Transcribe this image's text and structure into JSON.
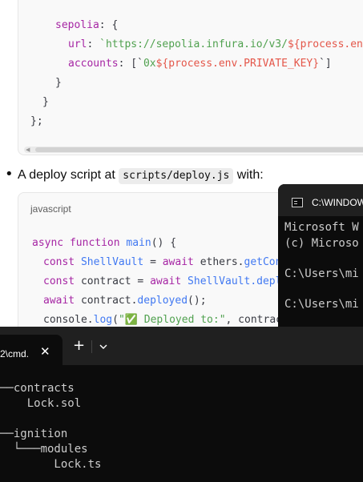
{
  "config_code": {
    "line1_key": "sepolia",
    "line1_rest": ": {",
    "line2_key": "url",
    "line2_colon": ": ",
    "line2_str": "`https://sepolia.infura.io/v3/",
    "line2_var": "${process.env",
    "line3_key": "accounts",
    "line3_pre": ": [`",
    "line3_str": "0x",
    "line3_var": "${process.env.PRIVATE_KEY}",
    "line3_post": "`]",
    "line4": "}",
    "line5": "}",
    "line6": "};"
  },
  "bullet": {
    "text_before": "A deploy script at ",
    "code": "scripts/deploy.js",
    "text_after": " with:"
  },
  "deploy_code": {
    "language": "javascript",
    "l1_kw": "async function ",
    "l1_fn": "main",
    "l1_rest": "() {",
    "l2_kw": "const ",
    "l2_cls": "ShellVault",
    "l2_eq": " = ",
    "l2_await": "await ",
    "l2_obj": "ethers.",
    "l2_fn": "getCon",
    "l3_kw": "const ",
    "l3_var": "contract",
    "l3_eq": " = ",
    "l3_await": "await ",
    "l3_cls": "ShellVault.",
    "l3_fn": "depl",
    "l4_await": "await ",
    "l4_obj": "contract.",
    "l4_fn": "deployed",
    "l4_rest": "();",
    "l5_obj": "console.",
    "l5_fn": "log",
    "l5_paren": "(",
    "l5_str": "\"✅ Deployed to:\"",
    "l5_rest": ", contrac"
  },
  "cmd_small": {
    "title": "C:\\WINDOW",
    "line1": "Microsoft W",
    "line2": "(c) Microso",
    "line3": "C:\\Users\\mi",
    "line4": "C:\\Users\\mi"
  },
  "terminal": {
    "tab_title": "2\\cmd.",
    "close_glyph": "✕",
    "new_tab_glyph": "+",
    "tree": [
      "──contracts",
      "    Lock.sol",
      "",
      "──ignition",
      "  └───modules",
      "        Lock.ts"
    ]
  }
}
